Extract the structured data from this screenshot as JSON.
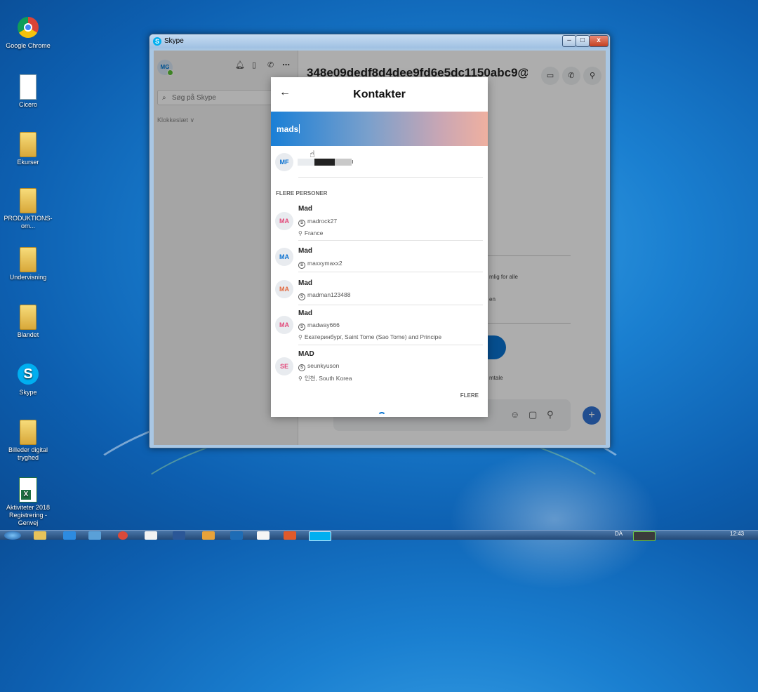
{
  "desktop": {
    "icons": [
      {
        "label": "Google Chrome"
      },
      {
        "label": "Cicero"
      },
      {
        "label": "Ekurser"
      },
      {
        "label": "PRODUKTIONS-om..."
      },
      {
        "label": "Undervisning"
      },
      {
        "label": "Blandet"
      },
      {
        "label": "Skype"
      },
      {
        "label": "Billeder digital tryghed"
      },
      {
        "label": "Aktiviteter 2018 Registrering - Genvej"
      }
    ]
  },
  "window": {
    "title": "Skype",
    "minimize": "–",
    "maximize": "□",
    "close": "x"
  },
  "sidebar": {
    "avatar_initials": "MG",
    "search_placeholder": "Søg på Skype",
    "sort_label": "Klokkeslæt ∨"
  },
  "chat": {
    "title": "348e09dedf8d4dee9fd6e5dc1150abc9@thı",
    "partial_texts": [
      "mlig for alle",
      "en",
      "mtale"
    ]
  },
  "modal": {
    "title": "Kontakter",
    "search_value": "mads",
    "top_result": {
      "initials": "MF",
      "name_end": "ı"
    },
    "section_label": "FLERE PERSONER",
    "more_label": "FLERE",
    "results": [
      {
        "initials": "MA",
        "name": "Mad",
        "username": "madrock27",
        "location": "France",
        "color": "pink"
      },
      {
        "initials": "MA",
        "name": "Mad",
        "username": "maxxymaxx2",
        "location": "",
        "color": "blue"
      },
      {
        "initials": "MA",
        "name": "Mad",
        "username": "madman123488",
        "location": "",
        "color": "orange"
      },
      {
        "initials": "MA",
        "name": "Mad",
        "username": "madway666",
        "location": "Екатеринбург, Saint Tome (Sao Tome) and Principe",
        "color": "pink"
      },
      {
        "initials": "SE",
        "name": "MAD",
        "username": "seunkyuson",
        "location": "인천, South Korea",
        "color": "pink"
      }
    ]
  },
  "taskbar": {
    "language": "DA",
    "time": "12:43"
  },
  "colors": {
    "skype_blue": "#00aff0",
    "accent_blue": "#0a74d1",
    "avatar_pink": "#e2497a",
    "avatar_orange": "#e26a3f"
  }
}
